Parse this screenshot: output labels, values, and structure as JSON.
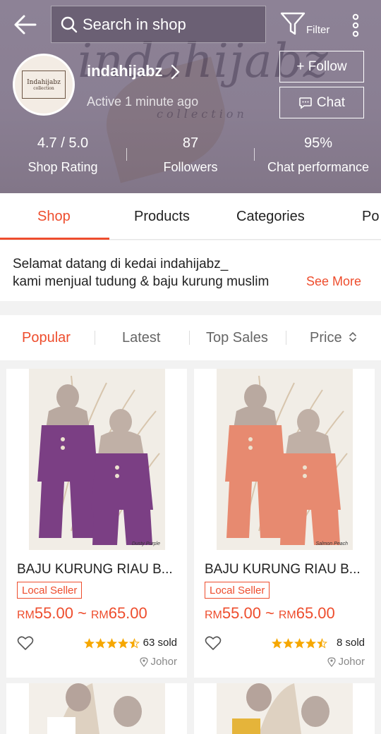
{
  "header": {
    "search_placeholder": "Search in shop",
    "filter_label": "Filter",
    "watermark": "indahijabz",
    "watermark_sub": "collection"
  },
  "shop": {
    "name": "indahijabz",
    "avatar_brand": "Indahijabz",
    "avatar_sub": "collection",
    "status": "Active 1 minute ago",
    "follow_label": "+ Follow",
    "chat_label": "Chat",
    "stats": [
      {
        "value": "4.7 / 5.0",
        "label": "Shop Rating"
      },
      {
        "value": "87",
        "label": "Followers"
      },
      {
        "value": "95%",
        "label": "Chat performance"
      }
    ]
  },
  "tabs": [
    "Shop",
    "Products",
    "Categories",
    "Po"
  ],
  "description": {
    "line1": "Selamat datang di kedai indahijabz_",
    "line2": "kami menjual tudung & baju kurung muslim",
    "see_more": "See More"
  },
  "sort": [
    "Popular",
    "Latest",
    "Top Sales",
    "Price"
  ],
  "products": [
    {
      "title": "BAJU KURUNG RIAU B...",
      "badge": "Local Seller",
      "currency": "RM",
      "price_min": "55.00",
      "price_sep": "~",
      "price_max": "65.00",
      "rating": 4.5,
      "sold": "63 sold",
      "location": "Johor",
      "image_caption": "Dusty Purple",
      "image_color": "#7b3f84"
    },
    {
      "title": "BAJU KURUNG RIAU B...",
      "badge": "Local Seller",
      "currency": "RM",
      "price_min": "55.00",
      "price_sep": "~",
      "price_max": "65.00",
      "rating": 4.5,
      "sold": "8 sold",
      "location": "Johor",
      "image_caption": "Salmon Peach",
      "image_color": "#e78a70"
    }
  ],
  "colors": {
    "accent": "#ee4d2d",
    "header_bg": "#8a7f93",
    "star": "#f6a700"
  }
}
